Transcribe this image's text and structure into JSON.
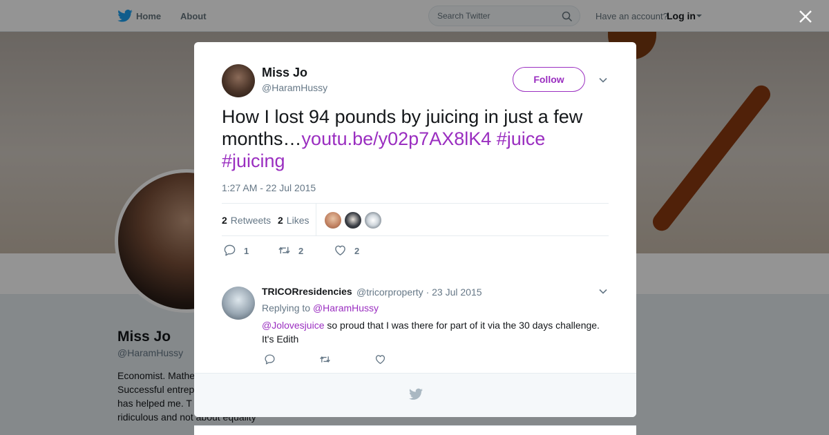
{
  "nav": {
    "home_label": "Home",
    "about_label": "About",
    "search_placeholder": "Search Twitter",
    "account_prompt": "Have an account?",
    "login_label": "Log in"
  },
  "profile": {
    "name": "Miss Jo",
    "handle": "@HaramHussy",
    "bio": "Economist. Mathe\nSuccessful entrep\nhas helped me. T\nridiculous and not about equality"
  },
  "tweet": {
    "author_name": "Miss Jo",
    "author_handle": "@HaramHussy",
    "follow_label": "Follow",
    "text_plain": "How I lost 94 pounds by juicing in just a few months…",
    "link": "youtu.be/y02p7AX8lK4",
    "hashtag_1": "#juice",
    "hashtag_2": "#juicing",
    "timestamp": "1:27 AM - 22 Jul 2015",
    "retweets_count": "2",
    "retweets_label": "Retweets",
    "likes_count": "2",
    "likes_label": "Likes",
    "reply_count": "1",
    "retweet_action_count": "2",
    "like_action_count": "2"
  },
  "reply": {
    "author_name": "TRICORresidencies",
    "author_handle": "@tricorproperty",
    "date": "23 Jul 2015",
    "meta_separator": "·",
    "replying_to_label": "Replying to",
    "replying_to_handle": "@HaramHussy",
    "mention": "@Jolovesjuice",
    "text": " so proud that I was there for part of it via the 30 days challenge. It's Edith"
  },
  "colors": {
    "accent": "#9a2ec0",
    "twitter_blue": "#1da1f2",
    "muted_text": "#657786"
  },
  "icons": {
    "nav_logo": "twitter-bird-icon",
    "search": "search-icon",
    "close": "close-icon",
    "chevron": "chevron-down-icon",
    "reply": "reply-icon",
    "retweet": "retweet-icon",
    "like": "heart-icon",
    "footer": "twitter-bird-icon"
  }
}
